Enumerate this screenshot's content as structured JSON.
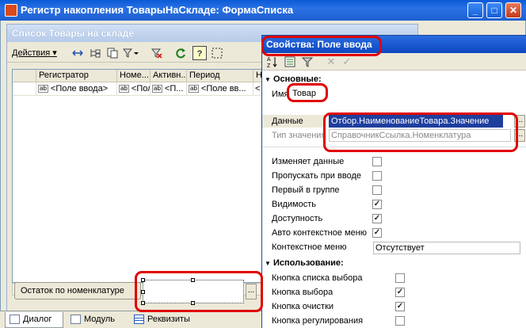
{
  "window": {
    "title": "Регистр накопления ТоварыНаСкладе: ФормаСписка",
    "minimize": "_",
    "maximize": "□",
    "close": "✕"
  },
  "form": {
    "title": "Список Товары на складе",
    "actions_label": "Действия",
    "actions_arrow": "▾"
  },
  "grid": {
    "columns": [
      "Регистратор",
      "Номе...",
      "Активн...",
      "Период",
      "На"
    ],
    "row": [
      "<Поле ввода>",
      "<Поле...",
      "<П...",
      "<Поле вв...",
      "<"
    ]
  },
  "remains_label": "Остаток по номенклатуре",
  "new_field_button": "...",
  "tabs": [
    "Диалог",
    "Модуль",
    "Реквизиты"
  ],
  "props": {
    "title": "Свойства: Поле ввода",
    "sections": {
      "main": "Основные:",
      "usage": "Использование:"
    },
    "name_label": "Имя",
    "name_value": "Товар",
    "data_label": "Данные",
    "data_value": "Отбор.НаименованиеТовара.Значение",
    "type_label": "Тип значения",
    "type_value": "СправочникСсылка.Номенклатура",
    "dots": "...",
    "flags": [
      {
        "label": "Изменяет данные",
        "checked": false
      },
      {
        "label": "Пропускать при вводе",
        "checked": false
      },
      {
        "label": "Первый в группе",
        "checked": false
      },
      {
        "label": "Видимость",
        "checked": true
      },
      {
        "label": "Доступность",
        "checked": true
      },
      {
        "label": "Авто контекстное меню",
        "checked": true
      }
    ],
    "context_menu_label": "Контекстное меню",
    "context_menu_value": "Отсутствует",
    "usage_flags": [
      {
        "label": "Кнопка списка выбора",
        "checked": false
      },
      {
        "label": "Кнопка выбора",
        "checked": true
      },
      {
        "label": "Кнопка очистки",
        "checked": true
      },
      {
        "label": "Кнопка регулирования",
        "checked": false
      }
    ]
  },
  "colors": {
    "highlight": "#e00000",
    "title_blue": "#0a5ad6",
    "selection": "#1f3f9e"
  }
}
